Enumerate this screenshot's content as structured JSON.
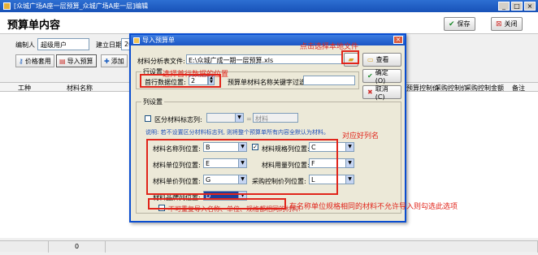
{
  "window": {
    "title": "[众城广场A座一层预算_众城广场A座一层]编辑",
    "controls": [
      "_",
      "□",
      "×"
    ]
  },
  "header": {
    "page_title": "预算单内容",
    "save_label": "保存",
    "close_label": "关闭"
  },
  "info": {
    "compiler_label": "编制人",
    "compiler_value": "超级用户",
    "date_label": "建立日期",
    "date_value": "20"
  },
  "toolbar": {
    "price_label": "价格套用",
    "import_label": "导入预算",
    "add_label": "添加"
  },
  "grid": {
    "columns_left": [
      "工种",
      "材料名称"
    ],
    "columns_right": [
      "预算控制价",
      "采购控制价",
      "采购控制金额",
      "备注"
    ]
  },
  "status": {
    "count": "0"
  },
  "dialog": {
    "title": "导入预算单",
    "file_label": "材料分析表文件:",
    "file_value": "E:\\众城广成一期一层预算.xls",
    "view_label": "查看",
    "ok_label": "确定(O)",
    "cancel_label": "取消(C)",
    "row_group_title": "行设置",
    "first_row_label": "首行数据位置:",
    "first_row_value": "2",
    "keyword_label": "预算单材料名称关键字过滤",
    "keyword_value": "",
    "column_group_title": "列设置",
    "distinguish_label": "区分材料标志列:",
    "distinguish_value": "",
    "marker_label": "=",
    "marker_value": "材料",
    "note": "说明: 若不设置区分材料标志列, 则将整个预算单所有内容全默认为材料。",
    "name_col_label": "材料名称列位置:",
    "name_col_value": "B",
    "spec_col_label": "材料规格列位置:",
    "spec_col_value": "C",
    "unit_col_label": "材料单位列位置:",
    "unit_col_value": "E",
    "qty_col_label": "材料用量列位置:",
    "qty_col_value": "F",
    "price_col_label": "材料单价列位置:",
    "price_col_value": "G",
    "purchase_col_label": "采购控制价列位置:",
    "purchase_col_value": "L",
    "brand_col_label": "材料品牌列位置:",
    "brand_col_value": "D",
    "no_dup_label": "不可重复导入名称、单位、规格都相同的材料!"
  },
  "annotations": {
    "choose_file": "点击选择本地文件",
    "first_row": "选择首行数据的位置",
    "column_names": "对应好列名",
    "duplicate": "有名称单位规格相同的材料不允许导入则勾选此选项"
  },
  "colors": {
    "annotation": "#e1251b",
    "title_bar": "#1b56c4",
    "dialog_bg": "#ece9d8"
  }
}
